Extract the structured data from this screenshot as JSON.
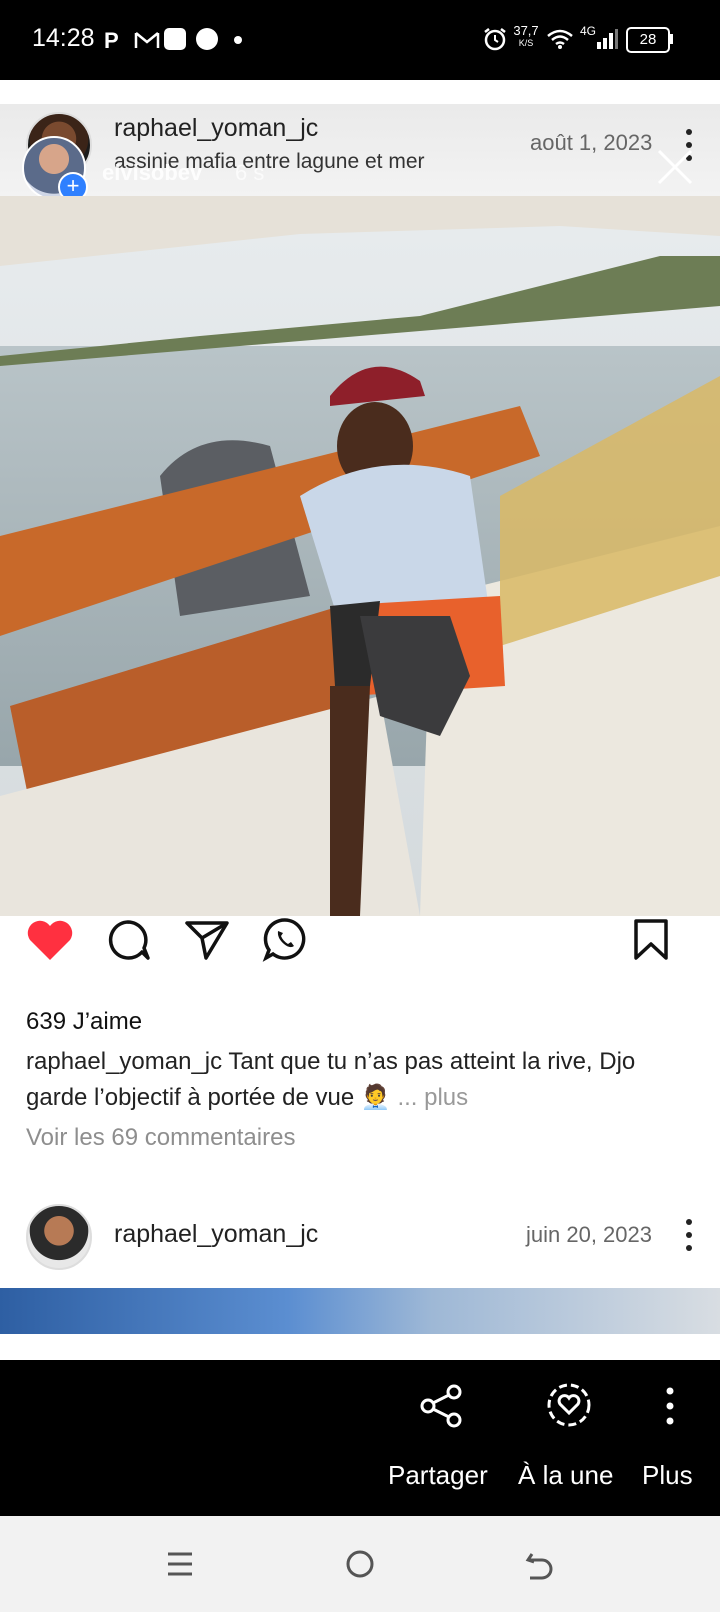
{
  "status_bar": {
    "time": "14:28",
    "left_icons": [
      "p-icon",
      "gmail-icon",
      "app-icon",
      "circle-icon",
      "dot-icon"
    ],
    "speed": "37,7",
    "speed_unit": "K/S",
    "network": "4G",
    "battery": "28"
  },
  "story": {
    "viewer_username": "elvisobev",
    "viewer_time": "6 s",
    "progress_segments": 3,
    "active_segment": 2
  },
  "post": {
    "username": "raphael_yoman_jc",
    "subtitle": "assinie mafia entre lagune et mer",
    "date": "août 1, 2023",
    "likes": "639 J’aime",
    "caption_user": "raphael_yoman_jc",
    "caption_text": "Tant que tu n’as pas atteint la rive, Djo garde l’objectif à portée de vue",
    "caption_emoji": "🧑‍💼",
    "more_label": "... plus",
    "comments": "Voir les 69 commentaires",
    "liked": true
  },
  "next_post": {
    "username": "raphael_yoman_jc",
    "date": "juin 20, 2023"
  },
  "share_bar": {
    "share_label": "Partager",
    "highlight_label": "À la une",
    "more_label": "Plus"
  },
  "colors": {
    "like_red": "#ff3040",
    "story_plus_blue": "#2f80ff"
  }
}
